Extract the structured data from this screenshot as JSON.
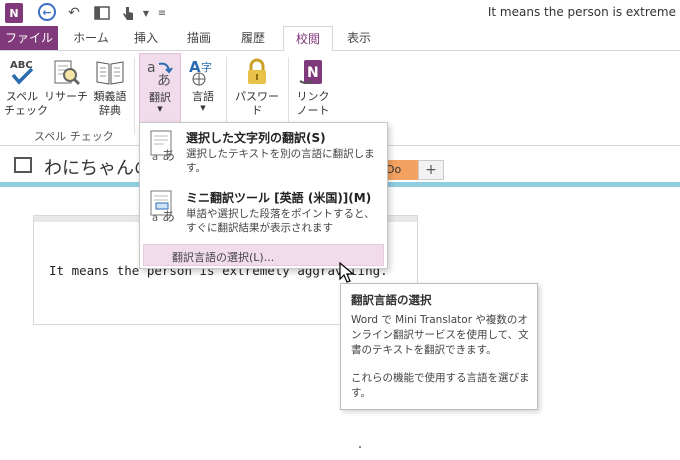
{
  "window": {
    "title": "It means the person is extreme",
    "app_logo": "N"
  },
  "tabs": [
    {
      "label": "ファイル"
    },
    {
      "label": "ホーム"
    },
    {
      "label": "挿入"
    },
    {
      "label": "描画"
    },
    {
      "label": "履歴"
    },
    {
      "label": "校閲"
    },
    {
      "label": "表示"
    }
  ],
  "ribbon": {
    "buttons": [
      {
        "label": "スペル\nチェック",
        "icon": "spell-check-icon"
      },
      {
        "label": "リサーチ",
        "icon": "research-icon"
      },
      {
        "label": "類義語\n辞典",
        "icon": "thesaurus-icon"
      },
      {
        "label": "翻訳",
        "icon": "translate-icon"
      },
      {
        "label": "言語",
        "icon": "language-icon"
      },
      {
        "label": "パスワード",
        "icon": "lock-icon"
      },
      {
        "label": "リンク\nノート",
        "icon": "linked-notes-icon"
      }
    ],
    "group_label": "スペル チェック"
  },
  "notebook": {
    "title": "わにちゃんの",
    "section_tab": "Do",
    "add_tab": "+"
  },
  "note": {
    "text": "It means the person is extremely aggravating."
  },
  "dropdown": {
    "item1_title": "選択した文字列の翻訳(S)",
    "item1_desc": "選択したテキストを別の言語に翻訳します。",
    "item2_title": "ミニ翻訳ツール [英語 (米国)](M)",
    "item2_desc": "単語や選択した段落をポイントすると、すぐに翻訳結果が表示されます",
    "choose_language": "翻訳言語の選択(L)..."
  },
  "tooltip": {
    "title": "翻訳言語の選択",
    "body": "Word で Mini Translator や複数のオンライン翻訳サービスを使用して、文書のテキストを翻訳できます。",
    "body2": "これらの機能で使用する言語を選びます。"
  },
  "colors": {
    "accent": "#80397b",
    "highlight": "#f1dcec",
    "section_tab": "#f4a261",
    "section_bar": "#8fcde0"
  }
}
